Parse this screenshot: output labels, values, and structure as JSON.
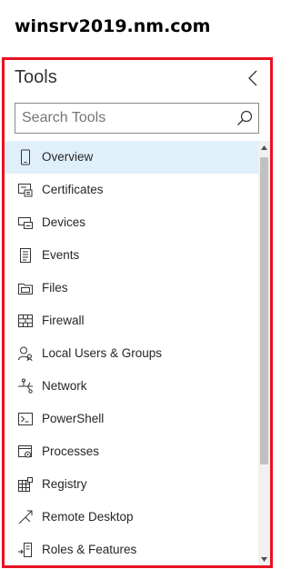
{
  "server": {
    "name": "winsrv2019.nm.com"
  },
  "panel": {
    "title": "Tools",
    "collapse_icon": "chevron-left-icon"
  },
  "search": {
    "placeholder": "Search Tools",
    "value": "",
    "icon": "search-icon"
  },
  "tools": [
    {
      "label": "Overview",
      "icon": "overview-icon",
      "selected": true
    },
    {
      "label": "Certificates",
      "icon": "certificates-icon",
      "selected": false
    },
    {
      "label": "Devices",
      "icon": "devices-icon",
      "selected": false
    },
    {
      "label": "Events",
      "icon": "events-icon",
      "selected": false
    },
    {
      "label": "Files",
      "icon": "files-icon",
      "selected": false
    },
    {
      "label": "Firewall",
      "icon": "firewall-icon",
      "selected": false
    },
    {
      "label": "Local Users & Groups",
      "icon": "users-groups-icon",
      "selected": false
    },
    {
      "label": "Network",
      "icon": "network-icon",
      "selected": false
    },
    {
      "label": "PowerShell",
      "icon": "powershell-icon",
      "selected": false
    },
    {
      "label": "Processes",
      "icon": "processes-icon",
      "selected": false
    },
    {
      "label": "Registry",
      "icon": "registry-icon",
      "selected": false
    },
    {
      "label": "Remote Desktop",
      "icon": "remote-desktop-icon",
      "selected": false
    },
    {
      "label": "Roles & Features",
      "icon": "roles-features-icon",
      "selected": false
    }
  ],
  "colors": {
    "highlight_border": "#e81123",
    "selected_background": "#e0f0fa",
    "scrollbar_thumb": "#c1c1c1"
  }
}
